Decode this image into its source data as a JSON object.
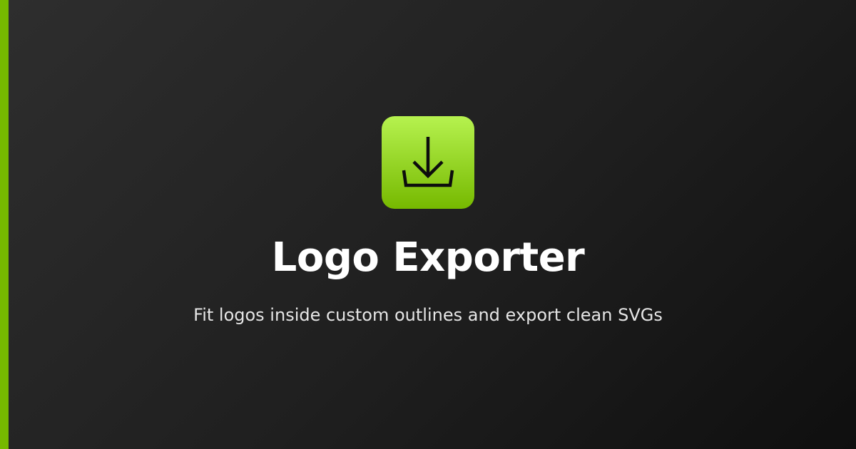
{
  "colors": {
    "accent": "#76b900",
    "icon_gradient_top": "#b6f24f",
    "icon_gradient_bottom": "#76b900",
    "icon_glyph": "#0d0d0d",
    "text_primary": "#ffffff",
    "text_secondary": "#e6e6e6"
  },
  "app_icon": {
    "icon": "download-tray-icon"
  },
  "title": "Logo Exporter",
  "subtitle": "Fit logos inside custom outlines and export clean SVGs"
}
